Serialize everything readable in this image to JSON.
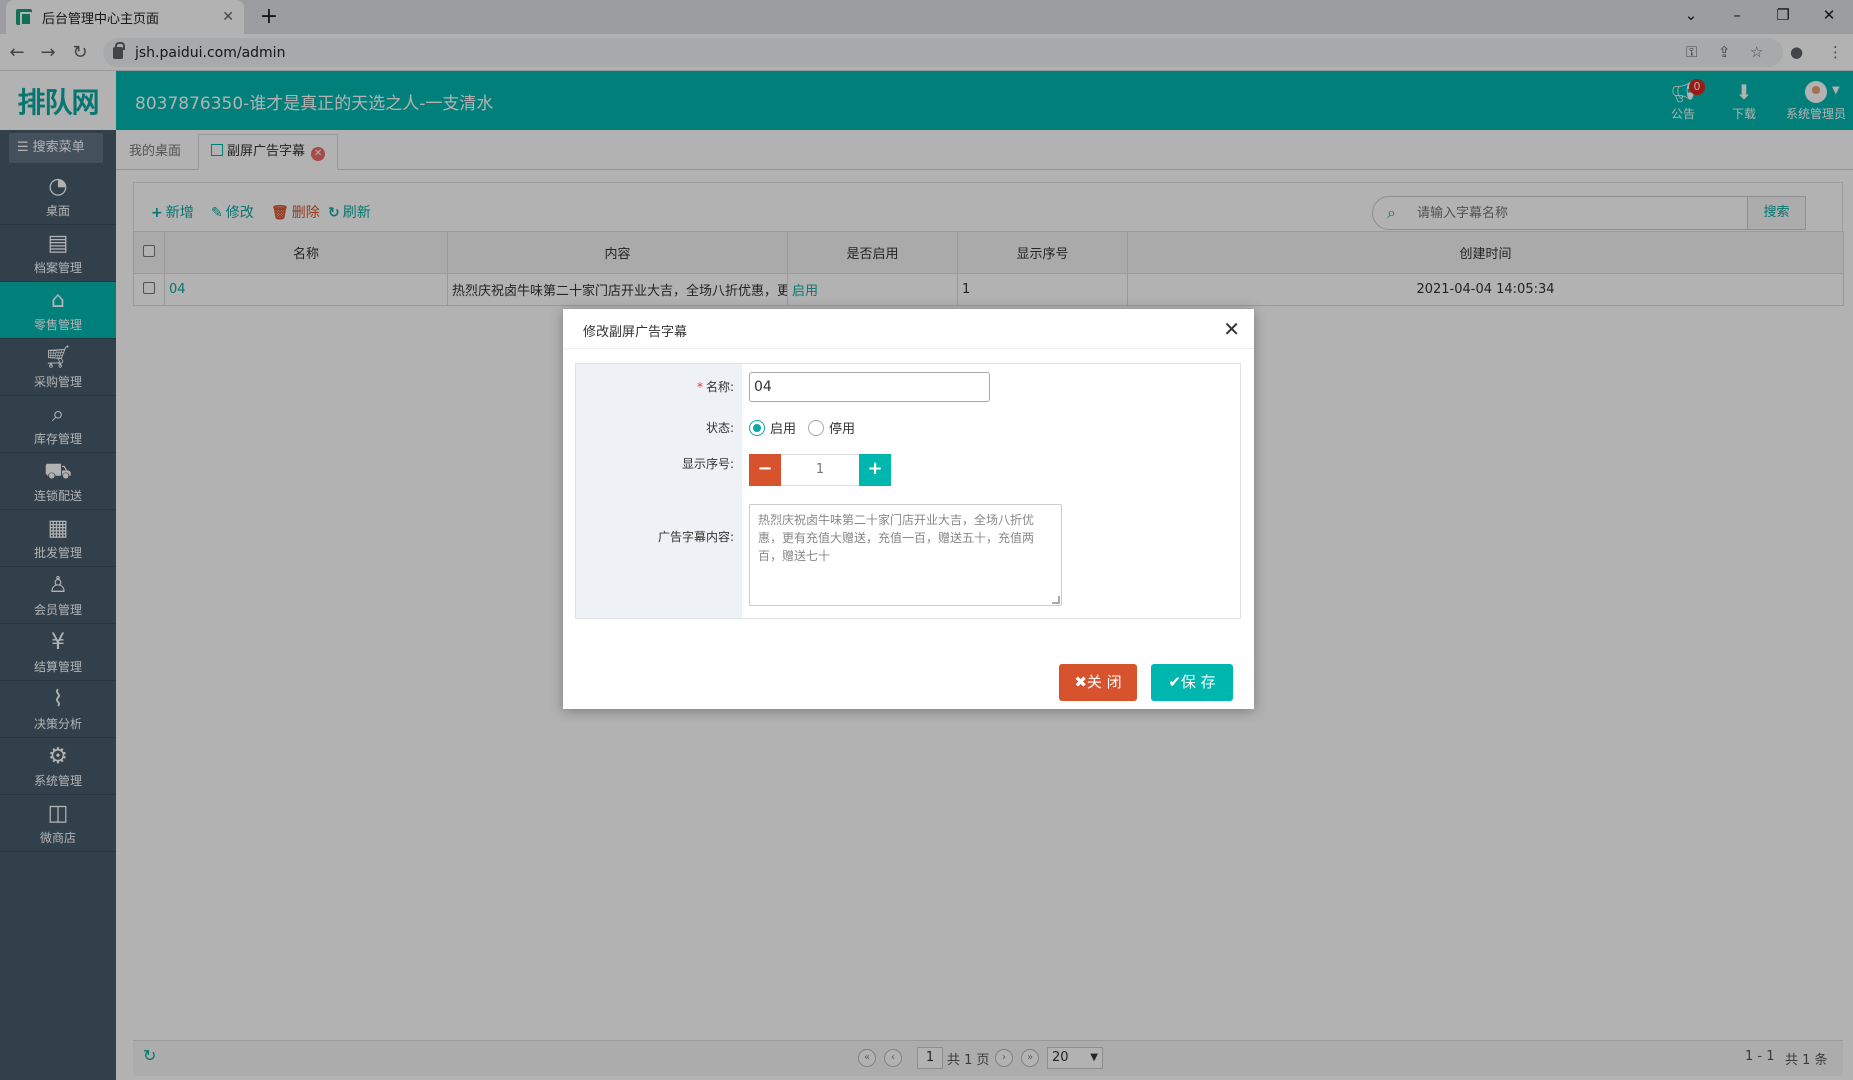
{
  "browser": {
    "tab_title": "后台管理中心主页面",
    "tab_close": "✕",
    "new_tab": "+",
    "url": "jsh.paidui.com/admin",
    "win_min": "–",
    "win_max": "❐",
    "win_close": "✕",
    "win_dropdown": "⌄"
  },
  "header": {
    "logo": "排队网",
    "title": "8037876350-谁才是真正的天选之人-一支清水",
    "notice_label": "公告",
    "notice_count": "0",
    "download_label": "下载",
    "user_label": "系统管理员"
  },
  "sidebar": {
    "search_label": "搜索菜单",
    "items": [
      {
        "label": "桌面"
      },
      {
        "label": "档案管理"
      },
      {
        "label": "零售管理"
      },
      {
        "label": "采购管理"
      },
      {
        "label": "库存管理"
      },
      {
        "label": "连锁配送"
      },
      {
        "label": "批发管理"
      },
      {
        "label": "会员管理"
      },
      {
        "label": "结算管理"
      },
      {
        "label": "决策分析"
      },
      {
        "label": "系统管理"
      },
      {
        "label": "微商店"
      }
    ]
  },
  "tabs": {
    "home": "我的桌面",
    "current": "副屏广告字幕"
  },
  "toolbar": {
    "add": "新增",
    "edit": "修改",
    "delete": "删除",
    "refresh": "刷新",
    "search_placeholder": "请输入字幕名称",
    "search_btn": "搜索"
  },
  "grid": {
    "headers": [
      "名称",
      "内容",
      "是否启用",
      "显示序号",
      "创建时间"
    ],
    "row": {
      "name": "04",
      "content": "热烈庆祝卤牛味第二十家门店开业大吉，全场八折优惠，更有充值大赠送",
      "enabled": "启用",
      "order": "1",
      "created": "2021-04-04 14:05:34"
    }
  },
  "pager": {
    "page": "1",
    "total_pages": "共 1 页",
    "page_size": "20",
    "range": "1 - 1",
    "total": "共 1 条"
  },
  "dialog": {
    "title": "修改副屏广告字幕",
    "name_label": "名称:",
    "name_value": "04",
    "status_label": "状态:",
    "status_on": "启用",
    "status_off": "停用",
    "order_label": "显示序号:",
    "order_value": "1",
    "content_label": "广告字幕内容:",
    "content_value": "热烈庆祝卤牛味第二十家门店开业大吉，全场八折优惠，更有充值大赠送，充值一百，赠送五十，充值两百，赠送七十",
    "close_btn": "关 闭",
    "save_btn": "保 存"
  },
  "colors": {
    "brand": "#00b7b0",
    "danger": "#d6532d",
    "sidebar": "#485c6e"
  }
}
